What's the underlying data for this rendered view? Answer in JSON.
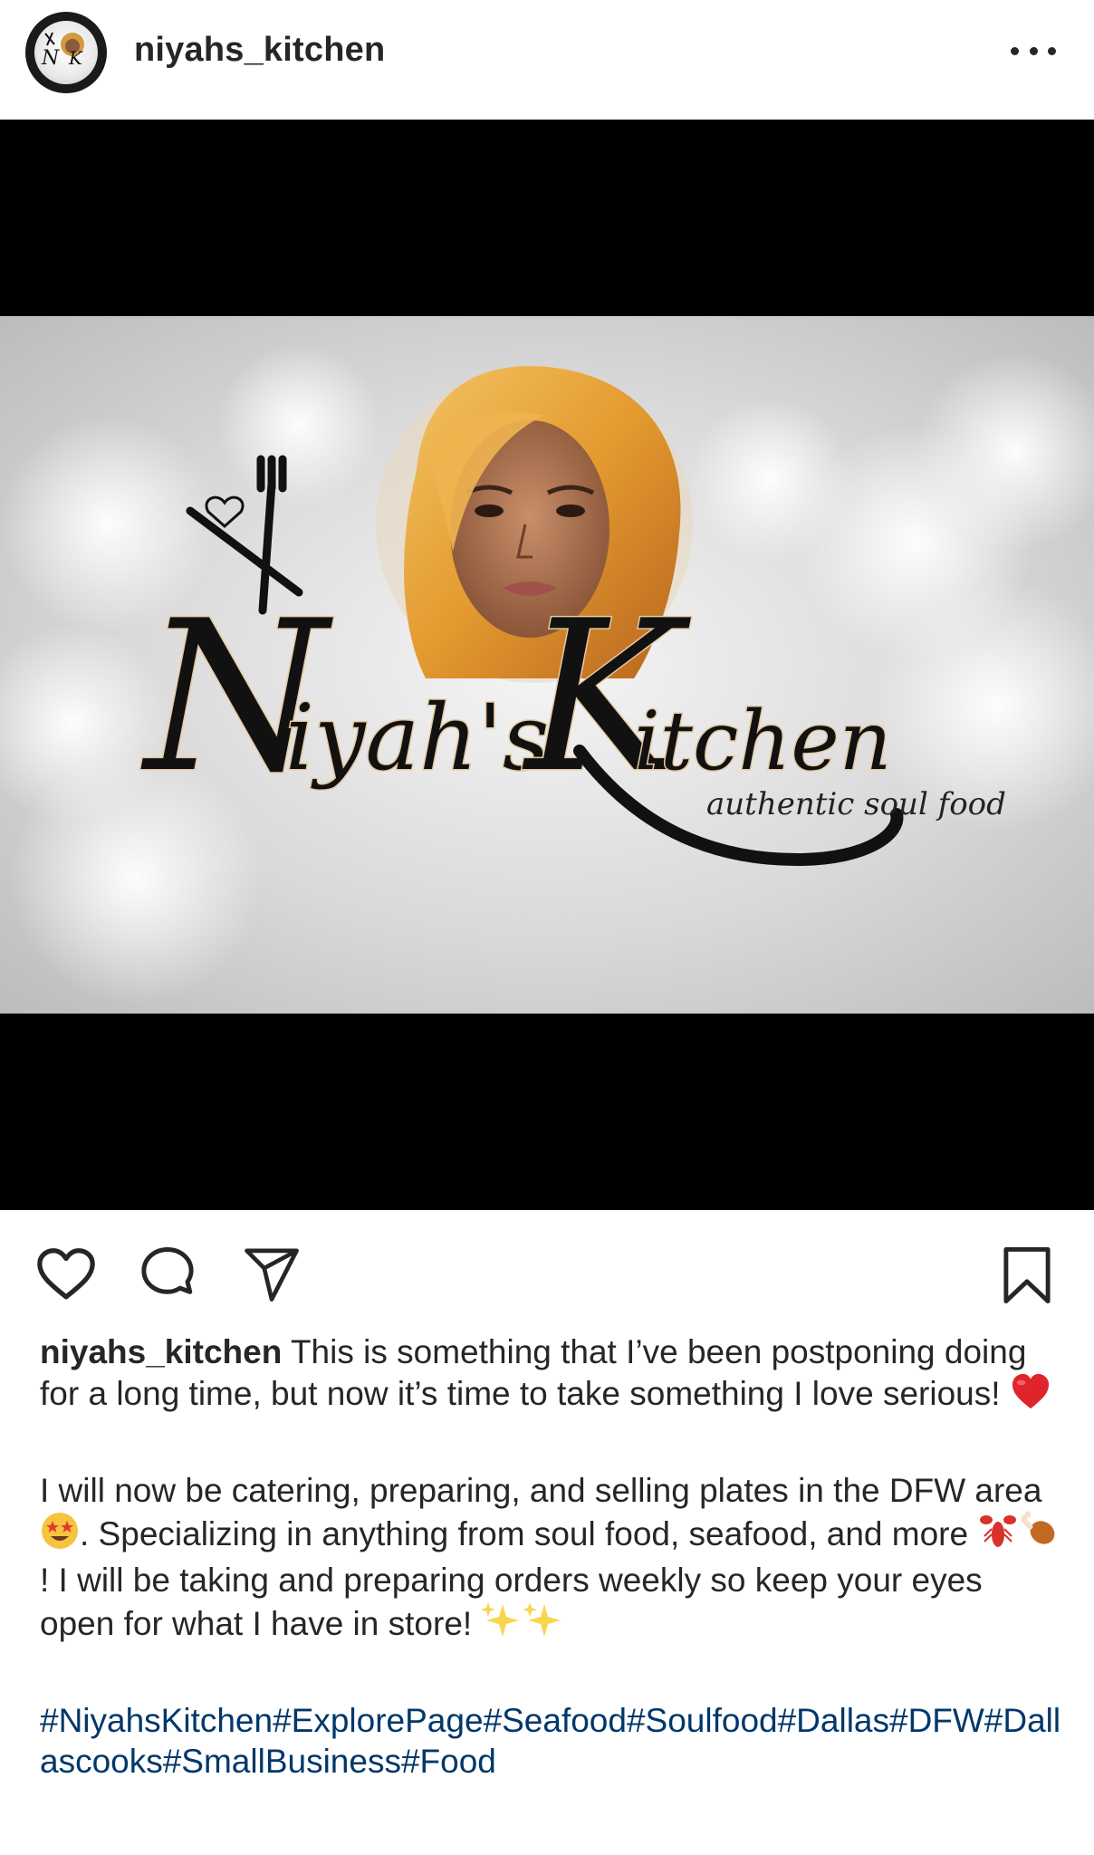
{
  "post": {
    "username": "niyahs_kitchen",
    "more_icon": "more-horizontal-icon",
    "image": {
      "logo_first": "N",
      "logo_rest": "iyah's",
      "logo_k": "K",
      "logo_itchen": "itchen",
      "tagline": "authentic soul food"
    },
    "actions": {
      "like_icon": "heart-icon",
      "comment_icon": "comment-icon",
      "share_icon": "send-icon",
      "save_icon": "bookmark-icon"
    },
    "caption": {
      "username": "niyahs_kitchen",
      "text_1": " This is something that I’ve been postponing doing for a long time, but now it’s time to take something I love serious! ",
      "text_2a": "I will now be catering, preparing, and selling plates in the DFW area ",
      "text_2b": ". Specializing in anything from soul food, seafood, and more ",
      "text_2c": "! I will be taking and preparing orders weekly so keep your eyes open for what I have in store! ",
      "hashtags": "#NiyahsKitchen#ExplorePage#Seafood#Soulfood#Dallas#DFW#Dallascooks#SmallBusiness#Food",
      "emojis": [
        "red-heart-emoji",
        "star-struck-emoji",
        "lobster-emoji",
        "poultry-leg-emoji",
        "sparkles-emoji",
        "sparkles-emoji"
      ]
    },
    "colors": {
      "text": "#262626",
      "hashtag": "#00376b",
      "heart_red": "#e0242b"
    }
  }
}
